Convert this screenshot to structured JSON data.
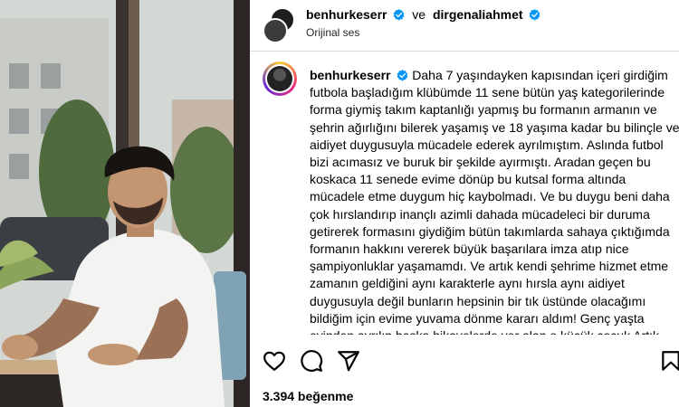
{
  "post": {
    "author": "benhurkeserr",
    "connector": "ve",
    "coauthor": "dirgenaliahmet",
    "audio": "Orijinal ses",
    "caption_author": "benhurkeserr",
    "caption": "Daha 7 yaşındayken kapısından içeri girdiğim futbola başladığım klübümde 11 sene bütün yaş kategorilerinde forma giymiş takım kaptanlığı yapmış bu formanın armanın ve şehrin ağırlığını bilerek yaşamış ve 18 yaşıma kadar bu bilinçle ve aidiyet duygusuyla mücadele ederek ayrılmıştım. Aslında futbol bizi acımasız ve buruk bir şekilde ayırmıştı. Aradan geçen bu koskaca 11 senede evime dönüp bu kutsal forma altında mücadele etme duygum hiç kaybolmadı. Ve bu duygu beni daha çok hırslandırıp inançlı azimli dahada mücadeleci bir duruma getirerek formasını giydiğim bütün takımlarda sahaya çıktığımda formanın hakkını vererek büyük başarılara imza atıp nice şampiyonluklar yaşamamdı. Ve artık kendi şehrime hizmet etme zamanın geldiğini aynı karakterle aynı hırsla aynı aidiyet duygusuyla değil bunların hepsinin bir tık üstünde olacağımı bildiğim için evime yuvama dönme kararı aldım! Genç yaşta evinden ayrılıp başka hikayelerde yer alan o küçük çocuk Artık",
    "likes": "3.394 beğenme"
  },
  "icons": {
    "verified": "verified-badge-icon",
    "like": "heart-icon",
    "comment": "comment-icon",
    "share": "paper-plane-icon",
    "save": "bookmark-icon"
  },
  "colors": {
    "verified": "#0095f6",
    "text": "#000000",
    "divider": "#dbdbdb"
  }
}
